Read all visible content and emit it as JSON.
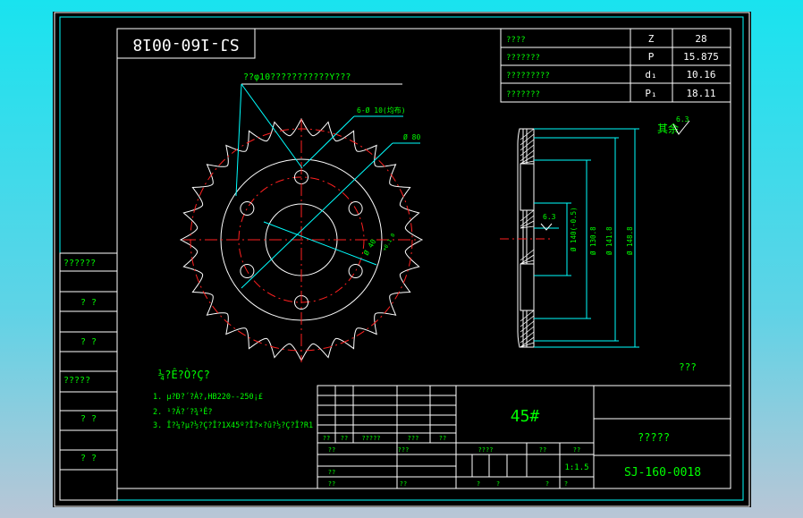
{
  "title_block": {
    "upside_label": "SJ-160-0018",
    "drawing_number": "SJ-160-0018",
    "material": "45#",
    "part_name": "?????",
    "scale": "1:1.5",
    "header_row": [
      "??",
      "??",
      "?????",
      "???",
      "??"
    ],
    "row_design": [
      "??",
      "",
      "",
      "???",
      ""
    ],
    "row_check": [
      "??"
    ],
    "row_approve": [
      "??",
      "",
      "??"
    ],
    "weight_row": [
      "????",
      "??",
      "??"
    ],
    "sheet_row": [
      "?",
      "?",
      "?",
      "?"
    ]
  },
  "param_table": [
    {
      "name": "????",
      "symbol": "Z",
      "value": "28"
    },
    {
      "name": "???????",
      "symbol": "P",
      "value": "15.875"
    },
    {
      "name": "?????????",
      "symbol": "d₁",
      "value": "10.16"
    },
    {
      "name": "???????",
      "symbol": "P₁",
      "value": "18.11"
    }
  ],
  "left_column_labels": [
    "??????",
    "? ?",
    "? ?",
    "?????",
    "? ?",
    "? ?"
  ],
  "annotations": {
    "top_note": "??φ10???????????Y???",
    "hole_callout": "6-Ø 10(均布)",
    "pcd_dim": "Ø 80",
    "bore_dim": "Ø 40",
    "bore_tol": "+0.1 0",
    "surface_rest": "其余",
    "surface_rest_value": "6.3",
    "surface_face": "6.3",
    "unknown_mark": "???"
  },
  "side_dims": [
    "Ø 140(-0.5)",
    "Ø 130.8",
    "Ø 141.8",
    "Ø 148.8"
  ],
  "tech_requirements": {
    "title": "¼?Ê?Ò?Ç?",
    "items": [
      "1. µ?Ð?´?À?,HB220--250¡£",
      "2. ¹?Ã?´?¾³Ê?",
      "3. Î?¼?µ?½?Ç?Î?1X45º?Î?×?û?½?Ç?Î?R1"
    ]
  },
  "colors": {
    "outline": "#ffffff",
    "text": "#00ff00",
    "dim": "#00ffff",
    "center": "#ff2020",
    "border": "#ffffff",
    "hatch": "#ffffff"
  }
}
